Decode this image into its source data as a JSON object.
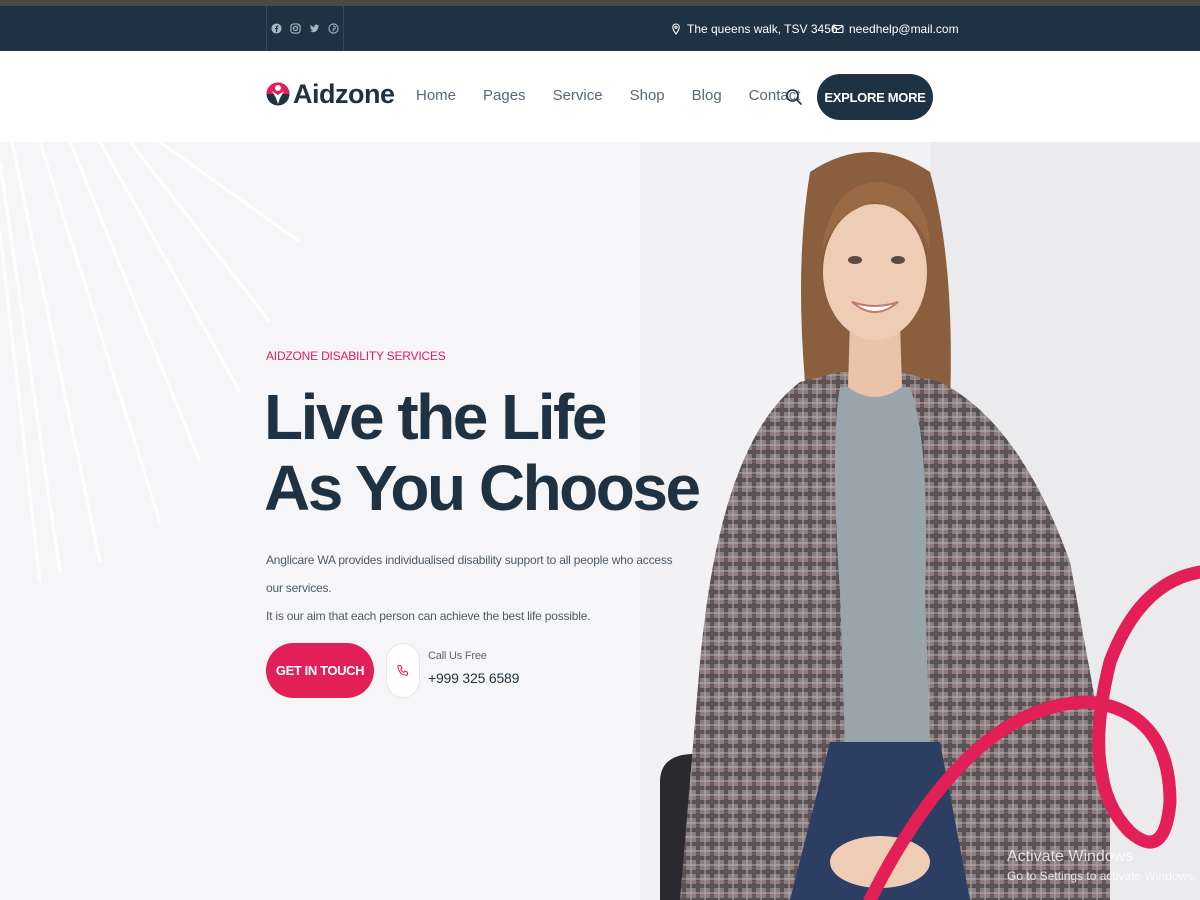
{
  "topbar": {
    "social_icons": [
      "facebook-icon",
      "instagram-icon",
      "twitter-icon",
      "pinterest-icon"
    ],
    "address": "The queens walk, TSV 3456",
    "email": "needhelp@mail.com"
  },
  "header": {
    "logo_text": "Aidzone",
    "nav": [
      "Home",
      "Pages",
      "Service",
      "Shop",
      "Blog",
      "Contact"
    ],
    "explore_label": "EXPLORE MORE"
  },
  "hero": {
    "eyebrow": "AIDZONE DISABILITY SERVICES",
    "title_line1": "Live the Life",
    "title_line2": "As You Choose",
    "desc_line1": "Anglicare WA provides individualised disability support to all people who access our services.",
    "desc_line2": "It is our aim that each person can achieve the best life possible.",
    "cta_label": "GET IN TOUCH",
    "call_label": "Call Us Free",
    "call_number": "+999 325 6589"
  },
  "watermark": {
    "title": "Activate Windows",
    "subtitle": "Go to Settings to activate Windows."
  },
  "colors": {
    "navy": "#1f3243",
    "accent": "#e21f57"
  }
}
